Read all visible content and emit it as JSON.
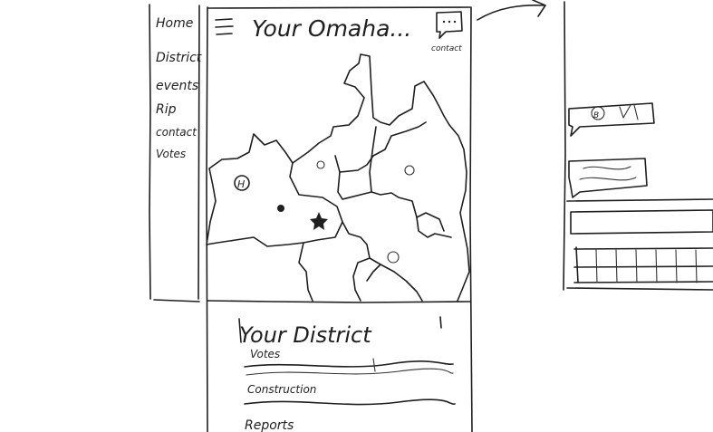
{
  "sidebar": {
    "items": [
      {
        "label": "Home"
      },
      {
        "label": "District"
      },
      {
        "label": "events"
      },
      {
        "label": "Rip"
      },
      {
        "label": "contact"
      },
      {
        "label": "Votes"
      }
    ]
  },
  "header": {
    "title": "Your Omaha...",
    "contact_label": "contact",
    "chat_icon": "chat-bubble-icon"
  },
  "district_panel": {
    "title": "Your District",
    "items": [
      {
        "label": "Votes"
      },
      {
        "label": "Construction"
      },
      {
        "label": "Reports"
      }
    ]
  },
  "map": {
    "markers": [
      "home-marker-icon",
      "star-marker-icon"
    ]
  }
}
